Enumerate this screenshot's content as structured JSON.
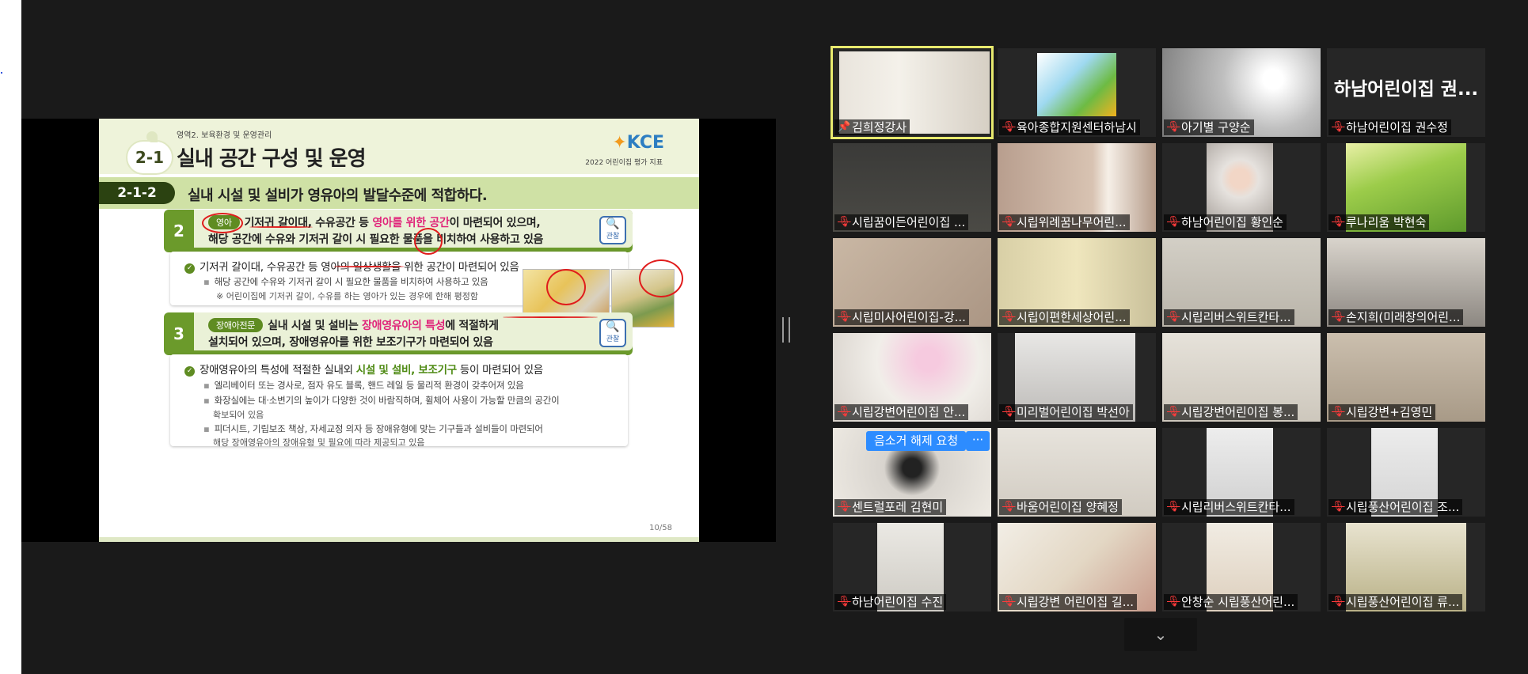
{
  "slide": {
    "header_sub": "영역2. 보육환경 및 운영관리",
    "badge": "2-1",
    "title": "실내 공간 구성 및 운영",
    "logo_text": "KCE",
    "logo_sub": "2022 어린이집 평가 지표",
    "item_code": "2-1-2",
    "item_title": "실내 시설 및 설비가 영유아의 발달수준에 적합하다.",
    "section2": {
      "num": "2",
      "pill": "영아",
      "line1_a": "기저귀 갈이대, 수유공간 등 ",
      "line1_pink": "영아를 위한 공간",
      "line1_b": "이 마련되어 있으며,",
      "line2": "해당 공간에 수유와 기저귀 갈이 시 필요한 물품을 비치하여 사용하고 있음",
      "icon_label": "관찰"
    },
    "card2": {
      "main": "기저귀 갈이대, 수유공간 등 영아의 일상생활을 위한 공간이 마련되어 있음",
      "bullet": "해당 공간에 수유와 기저귀 갈이 시 필요한 물품을 비치하여 사용하고 있음",
      "note": "※ 어린이집에 기저귀 갈이, 수유를 하는 영아가 있는 경우에 한해 평정함"
    },
    "section3": {
      "num": "3",
      "pill": "장애아전문",
      "line1_a": "실내 시설 및 설비는 ",
      "line1_pink": "장애영유아의 특성",
      "line1_b": "에 적절하게",
      "line2": "설치되어 있으며, 장애영유아를 위한 보조기구가 마련되어 있음",
      "icon_label": "관찰"
    },
    "card3": {
      "main_a": "장애영유아의 특성에 적절한 실내외 ",
      "main_green": "시설 및 설비, 보조기구",
      "main_b": " 등이 마련되어 있음",
      "bullets": [
        "엘리베이터 또는 경사로, 점자 유도 블록, 핸드 레일 등 물리적 환경이 갖추어져 있음",
        "화장실에는 대·소변기의 높이가 다양한 것이 바람직하며, 휠체어 사용이 가능할 만큼의 공간이",
        "확보되어 있음",
        "피더시트, 기립보조 책상, 자세교정 의자 등 장애유형에 맞는 기구들과 설비들이 마련되어",
        "해당 장애영유아의 장애유형 및 필요에 따라 제공되고 있음"
      ]
    },
    "page": "10/58"
  },
  "gallery": {
    "participants": [
      {
        "name": "김희정강사",
        "icon": "pin-icon"
      },
      {
        "name": "육아종합지원센터하남시",
        "icon": "mic-off-icon"
      },
      {
        "name": "아기별 구양순",
        "icon": "mic-off-icon"
      },
      {
        "name": "하남어린이집 권수정",
        "icon": "mic-off-icon",
        "display_name": "하남어린이집 권..."
      },
      {
        "name": "시립꿈이든어린이집 ...",
        "icon": "mic-off-icon"
      },
      {
        "name": "시립위례꿈나무어린...",
        "icon": "mic-off-icon"
      },
      {
        "name": "하남어린이집 황인순",
        "icon": "mic-off-icon"
      },
      {
        "name": "루나리움 박현숙",
        "icon": "mic-off-icon"
      },
      {
        "name": "시립미사어린이집-강...",
        "icon": "mic-off-icon"
      },
      {
        "name": "시립이편한세상어린...",
        "icon": "mic-off-icon"
      },
      {
        "name": "시립리버스위트칸타...",
        "icon": "mic-off-icon"
      },
      {
        "name": "손지희(미래창의어린...",
        "icon": "mic-off-icon"
      },
      {
        "name": "시립강변어린이집 안...",
        "icon": "mic-off-icon"
      },
      {
        "name": "미리벌어린이집 박선아",
        "icon": "mic-off-icon"
      },
      {
        "name": "시립강변어린이집 봉...",
        "icon": "mic-off-icon"
      },
      {
        "name": "시립강변+김영민",
        "icon": "mic-off-icon"
      },
      {
        "name": "센트럴포레 김현미",
        "icon": "mic-off-icon"
      },
      {
        "name": "바움어린이집 양혜정",
        "icon": "mic-off-icon"
      },
      {
        "name": "시립리버스위트칸타...",
        "icon": "mic-off-icon"
      },
      {
        "name": "시립풍산어린이집 조...",
        "icon": "mic-off-icon"
      },
      {
        "name": "하남어린이집 수진",
        "icon": "mic-off-icon"
      },
      {
        "name": "시립강변 어린이집 길...",
        "icon": "mic-off-icon"
      },
      {
        "name": "안창순 시립풍산어린...",
        "icon": "mic-off-icon"
      },
      {
        "name": "시립풍산어린이집 류...",
        "icon": "mic-off-icon"
      }
    ],
    "unmute_request": "음소거 해제 요청",
    "more": "···",
    "scroll_down": "chevron-down-icon"
  },
  "colors": {
    "active_speaker": "#e8ea6e",
    "mic_off": "#ff3b3b",
    "button_blue": "#2d8cff",
    "slide_green": "#6b9a2b",
    "highlight_pink": "#e0247a"
  }
}
